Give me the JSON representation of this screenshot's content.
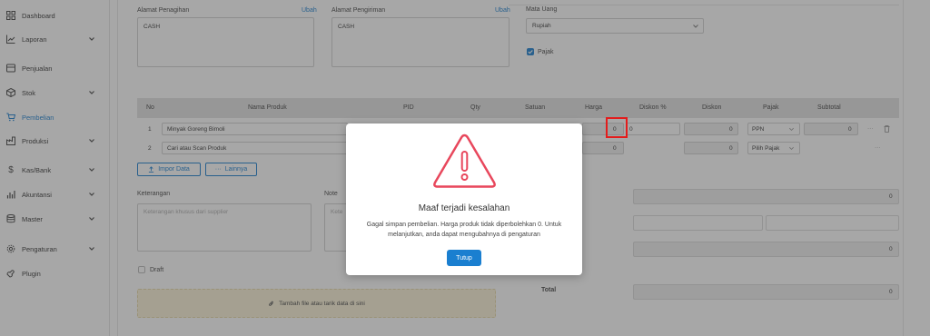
{
  "sidebar": {
    "items": [
      {
        "label": "Dashboard",
        "icon": "dashboard-icon",
        "has_children": false,
        "active": false
      },
      {
        "label": "Laporan",
        "icon": "chart-line-icon",
        "has_children": true,
        "active": false
      },
      {
        "label": "Penjualan",
        "icon": "receipt-icon",
        "has_children": false,
        "active": false
      },
      {
        "label": "Stok",
        "icon": "box-icon",
        "has_children": true,
        "active": false
      },
      {
        "label": "Pembelian",
        "icon": "cart-icon",
        "has_children": false,
        "active": true
      },
      {
        "label": "Produksi",
        "icon": "factory-icon",
        "has_children": true,
        "active": false
      },
      {
        "label": "Kas/Bank",
        "icon": "dollar-icon",
        "has_children": true,
        "active": false
      },
      {
        "label": "Akuntansi",
        "icon": "bar-chart-icon",
        "has_children": true,
        "active": false
      },
      {
        "label": "Master",
        "icon": "database-icon",
        "has_children": true,
        "active": false
      },
      {
        "label": "Pengaturan",
        "icon": "gear-icon",
        "has_children": true,
        "active": false
      },
      {
        "label": "Plugin",
        "icon": "plug-icon",
        "has_children": false,
        "active": false
      }
    ]
  },
  "form": {
    "billing_label": "Alamat Penagihan",
    "billing_edit": "Ubah",
    "billing_value": "CASH",
    "shipping_label": "Alamat Pengiriman",
    "shipping_edit": "Ubah",
    "shipping_value": "CASH",
    "currency_label": "Mata Uang",
    "currency_value": "Rupiah",
    "tax_label": "Pajak",
    "tax_checked": true
  },
  "table": {
    "headers": [
      "No",
      "Nama Produk",
      "PID",
      "Qty",
      "Satuan",
      "Harga",
      "Diskon %",
      "Diskon",
      "Pajak",
      "Subtotal"
    ],
    "rows": [
      {
        "no": "1",
        "product": "Minyak Goreng Bimoli",
        "harga": "0",
        "diskon_pct": "0",
        "diskon": "0",
        "pajak": "PPN",
        "subtotal": "0",
        "more": "···"
      },
      {
        "no": "2",
        "product_placeholder": "Cari atau Scan Produk",
        "harga": "0",
        "diskon": "0",
        "pajak": "Pilih Pajak",
        "more": "···"
      }
    ]
  },
  "actions": {
    "import_label": "Impor Data",
    "more_label": "Lainnya"
  },
  "notes": {
    "keterangan_label": "Keterangan",
    "keterangan_placeholder": "Keterangan khusus dari supplier",
    "note_label": "Note",
    "note_placeholder": "Kete"
  },
  "draft_label": "Draft",
  "dropzone_label": "Tambah file atau tarik data di sini",
  "summary": {
    "values": [
      "0",
      "",
      "0",
      "0"
    ],
    "total_label": "Total",
    "total_value": "0"
  },
  "modal": {
    "title": "Maaf terjadi kesalahan",
    "message": "Gagal simpan pembelian. Harga produk tidak diperbolehkan 0. Untuk melanjutkan, anda dapat mengubahnya di pengaturan",
    "button": "Tutup",
    "icon": "warning-triangle-icon"
  },
  "colors": {
    "accent": "#1a7fd0",
    "warning": "#e8475c",
    "highlight": "#e31c1c"
  }
}
